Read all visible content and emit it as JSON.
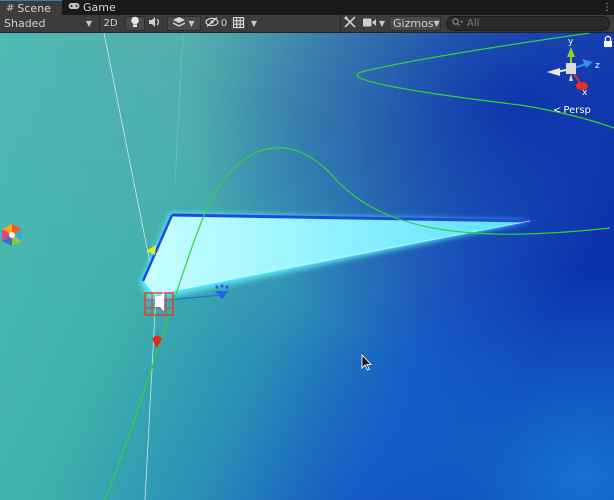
{
  "tabs": [
    {
      "label": "Scene",
      "icon": "grid-icon"
    },
    {
      "label": "Game",
      "icon": "gamepad-icon"
    }
  ],
  "toolbar": {
    "draw_mode": "Shaded",
    "mode_2d": "2D",
    "hidden_count": "0",
    "gizmos_label": "Gizmos",
    "search_placeholder": "All"
  },
  "gizmo": {
    "axis_y": "y",
    "axis_z": "z",
    "axis_x": "x",
    "projection": "Persp"
  },
  "colors": {
    "tab_active_border": "#3a79bb",
    "toolbar_bg": "#3c3c3c",
    "viewport_teal": "#3fb5b0",
    "viewport_blue": "#0f3fb6",
    "spline_green": "#28c832"
  }
}
